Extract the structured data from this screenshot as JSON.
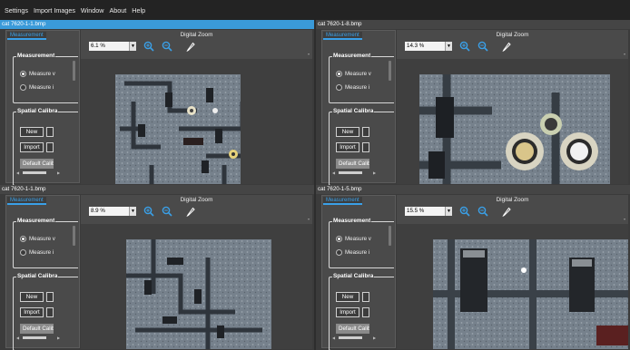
{
  "menu": [
    "Settings",
    "Import Images",
    "Window",
    "About",
    "Help"
  ],
  "windows": [
    {
      "title": "cat 7620-1-1.bmp",
      "zoom": "6.1 %",
      "active": true
    },
    {
      "title": "cat 7620-1-8.bmp",
      "zoom": "14.3 %",
      "active": false
    },
    {
      "title": "cat 7620-1-1.bmp",
      "zoom": "8.9 %",
      "active": false
    },
    {
      "title": "cat 7620-1-5.bmp",
      "zoom": "15.5 %",
      "active": false
    }
  ],
  "panel": {
    "tab": "Measurement",
    "measurement_group": "Measurement",
    "radio_1": "Measure v",
    "radio_2": "Measure i",
    "calibration_group": "Spatial Calibra",
    "new_btn": "New",
    "import_btn": "Import",
    "default_btn": "Default Calib"
  },
  "zoom": {
    "title": "Digital Zoom"
  },
  "icons": [
    "zoom-in-icon",
    "zoom-out-icon",
    "pencil-icon",
    "dropdown-arrow-icon"
  ],
  "colors": {
    "accent": "#3aa0e8",
    "active_title": "#3a9ad9",
    "background": "#2d2d2d"
  }
}
